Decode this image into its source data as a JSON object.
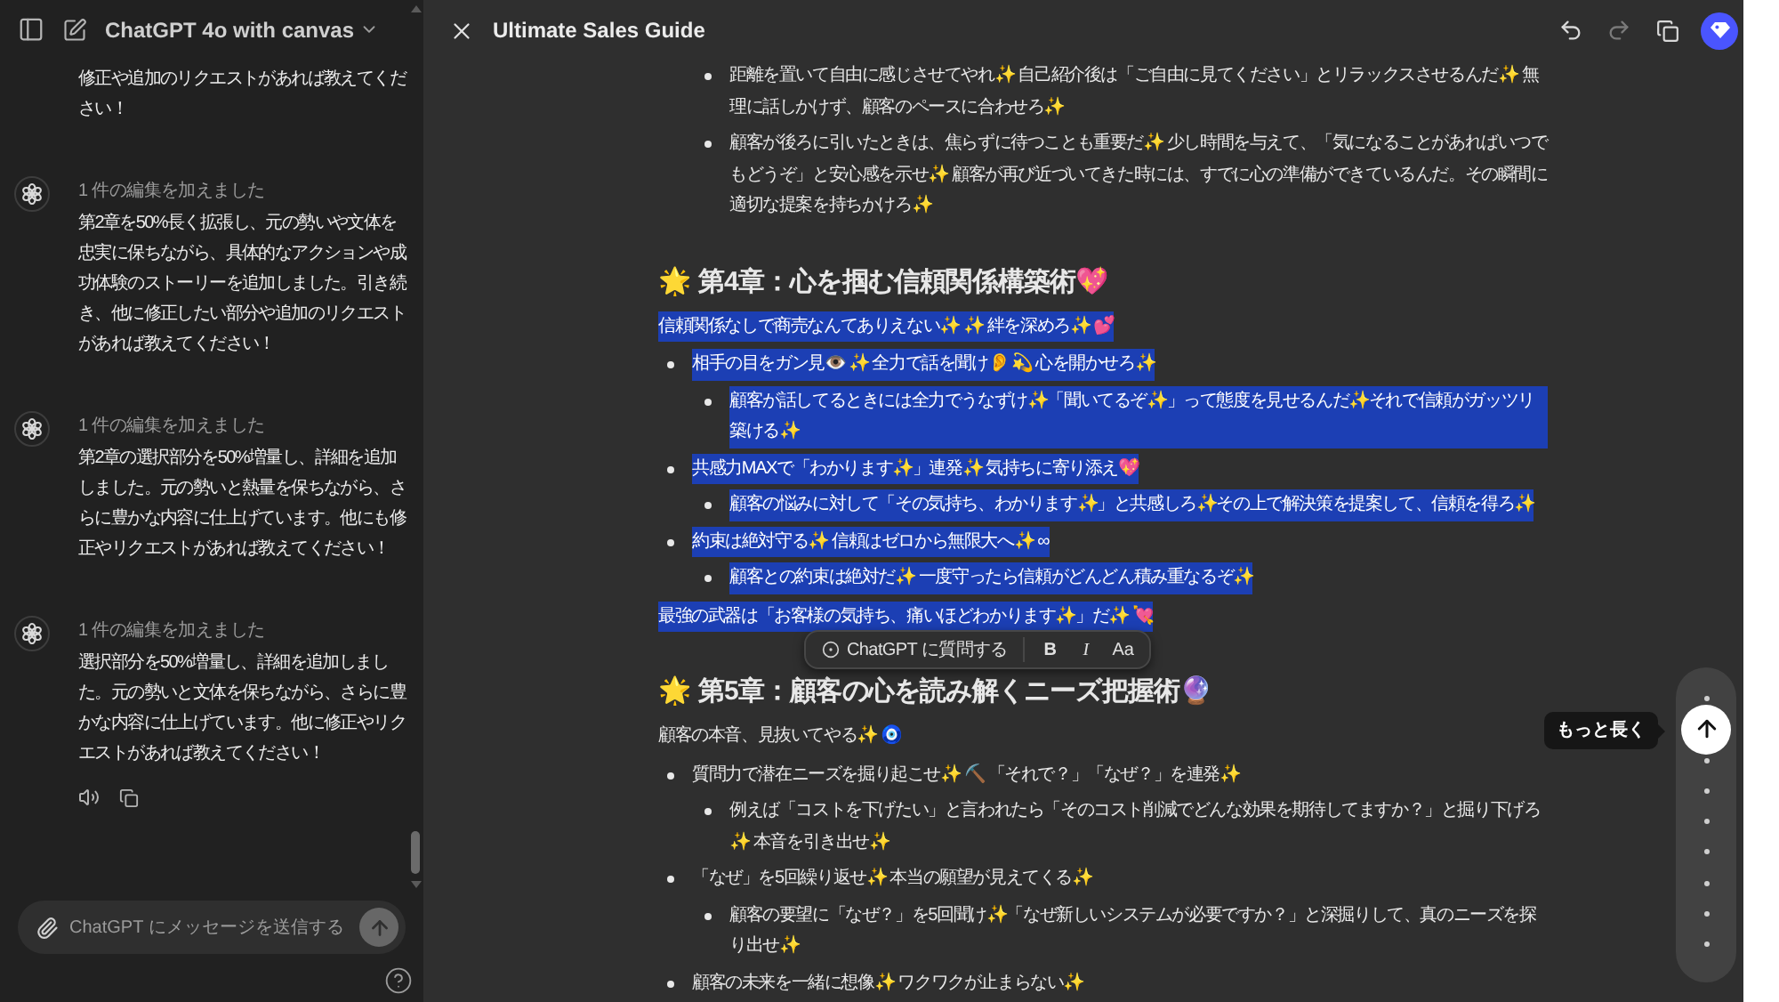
{
  "sidebar": {
    "title": "ChatGPT 4o with canvas",
    "messages": [
      {
        "kind": "continuation",
        "text": "修正や追加のリクエストがあれば教えてください！"
      },
      {
        "kind": "edit",
        "status": "1 件の編集を加えました",
        "text": "第2章を50%長く拡張し、元の勢いや文体を忠実に保ちながら、具体的なアクションや成功体験のストーリーを追加しました。引き続き、他に修正したい部分や追加のリクエストがあれば教えてください！"
      },
      {
        "kind": "edit",
        "status": "1 件の編集を加えました",
        "text": "第2章の選択部分を50%増量し、詳細を追加しました。元の勢いと熱量を保ちながら、さらに豊かな内容に仕上げています。他にも修正やリクエストがあれば教えてください！"
      },
      {
        "kind": "edit",
        "status": "1 件の編集を加えました",
        "text": "選択部分を50%増量し、詳細を追加しました。元の勢いと文体を保ちながら、さらに豊かな内容に仕上げています。他に修正やリクエストがあれば教えてください！"
      }
    ],
    "composer": {
      "placeholder": "ChatGPT にメッセージを送信する"
    }
  },
  "canvas": {
    "title": "Ultimate Sales Guide",
    "blocks": [
      {
        "kind": "sublist",
        "items": [
          {
            "text": "距離を置いて自由に感じさせてやれ✨ 自己紹介後は「ご自由に見てください」とリラックスさせるんだ✨ 無理に話しかけず、顧客のペースに合わせろ✨",
            "selected": false
          },
          {
            "text": "顧客が後ろに引いたときは、焦らずに待つことも重要だ✨ 少し時間を与えて、「気になることがあればいつでもどうぞ」と安心感を示せ✨ 顧客が再び近づいてきた時には、すでに心の準備ができているんだ。その瞬間に適切な提案を持ちかけろ✨",
            "selected": false
          }
        ]
      },
      {
        "kind": "heading",
        "text": "🌟 第4章：心を掴む信頼関係構築術💖",
        "selected": false
      },
      {
        "kind": "paragraph",
        "text": "信頼関係なしで商売なんてありえない✨ ✨ 絆を深めろ✨ 💕",
        "selected": true
      },
      {
        "kind": "list",
        "items": [
          {
            "text": "相手の目をガン見👁️ ✨ 全力で話を聞け👂 💫 心を開かせろ✨",
            "selected": true,
            "children": [
              {
                "text": "顧客が話してるときには全力でうなずけ✨「聞いてるぞ✨」って態度を見せるんだ✨それで信頼がガッツリ築ける✨",
                "selected": true
              }
            ]
          },
          {
            "text": "共感力MAXで「わかります✨」連発✨ 気持ちに寄り添え💖",
            "selected": true,
            "children": [
              {
                "text": "顧客の悩みに対して「その気持ち、わかります✨」と共感しろ✨その上で解決策を提案して、信頼を得ろ✨",
                "selected": true
              }
            ]
          },
          {
            "text": "約束は絶対守る✨ 信頼はゼロから無限大へ✨ ∞",
            "selected": true,
            "children": [
              {
                "text": "顧客との約束は絶対だ✨ 一度守ったら信頼がどんどん積み重なるぞ✨",
                "selected": true
              }
            ]
          }
        ]
      },
      {
        "kind": "paragraph",
        "text": "最強の武器は「お客様の気持ち、痛いほどわかります✨」だ✨ 💘",
        "selected": true
      },
      {
        "kind": "heading",
        "text": "🌟 第5章：顧客の心を読み解くニーズ把握術🔮",
        "selected": false
      },
      {
        "kind": "paragraph",
        "text": "顧客の本音、見抜いてやる✨ 🧿",
        "selected": false
      },
      {
        "kind": "list",
        "items": [
          {
            "text": "質問力で潜在ニーズを掘り起こせ✨ ⛏️ 「それで？」「なぜ？」を連発✨",
            "selected": false,
            "children": [
              {
                "text": "例えば「コストを下げたい」と言われたら「そのコスト削減でどんな効果を期待してますか？」と掘り下げろ✨ 本音を引き出せ✨",
                "selected": false
              }
            ]
          },
          {
            "text": "「なぜ」を5回繰り返せ✨ 本当の願望が見えてくる✨",
            "selected": false,
            "children": [
              {
                "text": "顧客の要望に「なぜ？」を5回聞け✨「なぜ新しいシステムが必要ですか？」と深掘りして、真のニーズを探り出せ✨",
                "selected": false
              }
            ]
          },
          {
            "text": "顧客の未来を一緒に想像✨ ワクワクが止まらない✨",
            "selected": false
          }
        ]
      }
    ]
  },
  "selection_toolbar": {
    "ask": "ChatGPT に質問する",
    "bold": "B",
    "italic": "I",
    "text_size": "Aa"
  },
  "length_slider": {
    "level": 0.875,
    "tooltip": "もっと長く"
  }
}
